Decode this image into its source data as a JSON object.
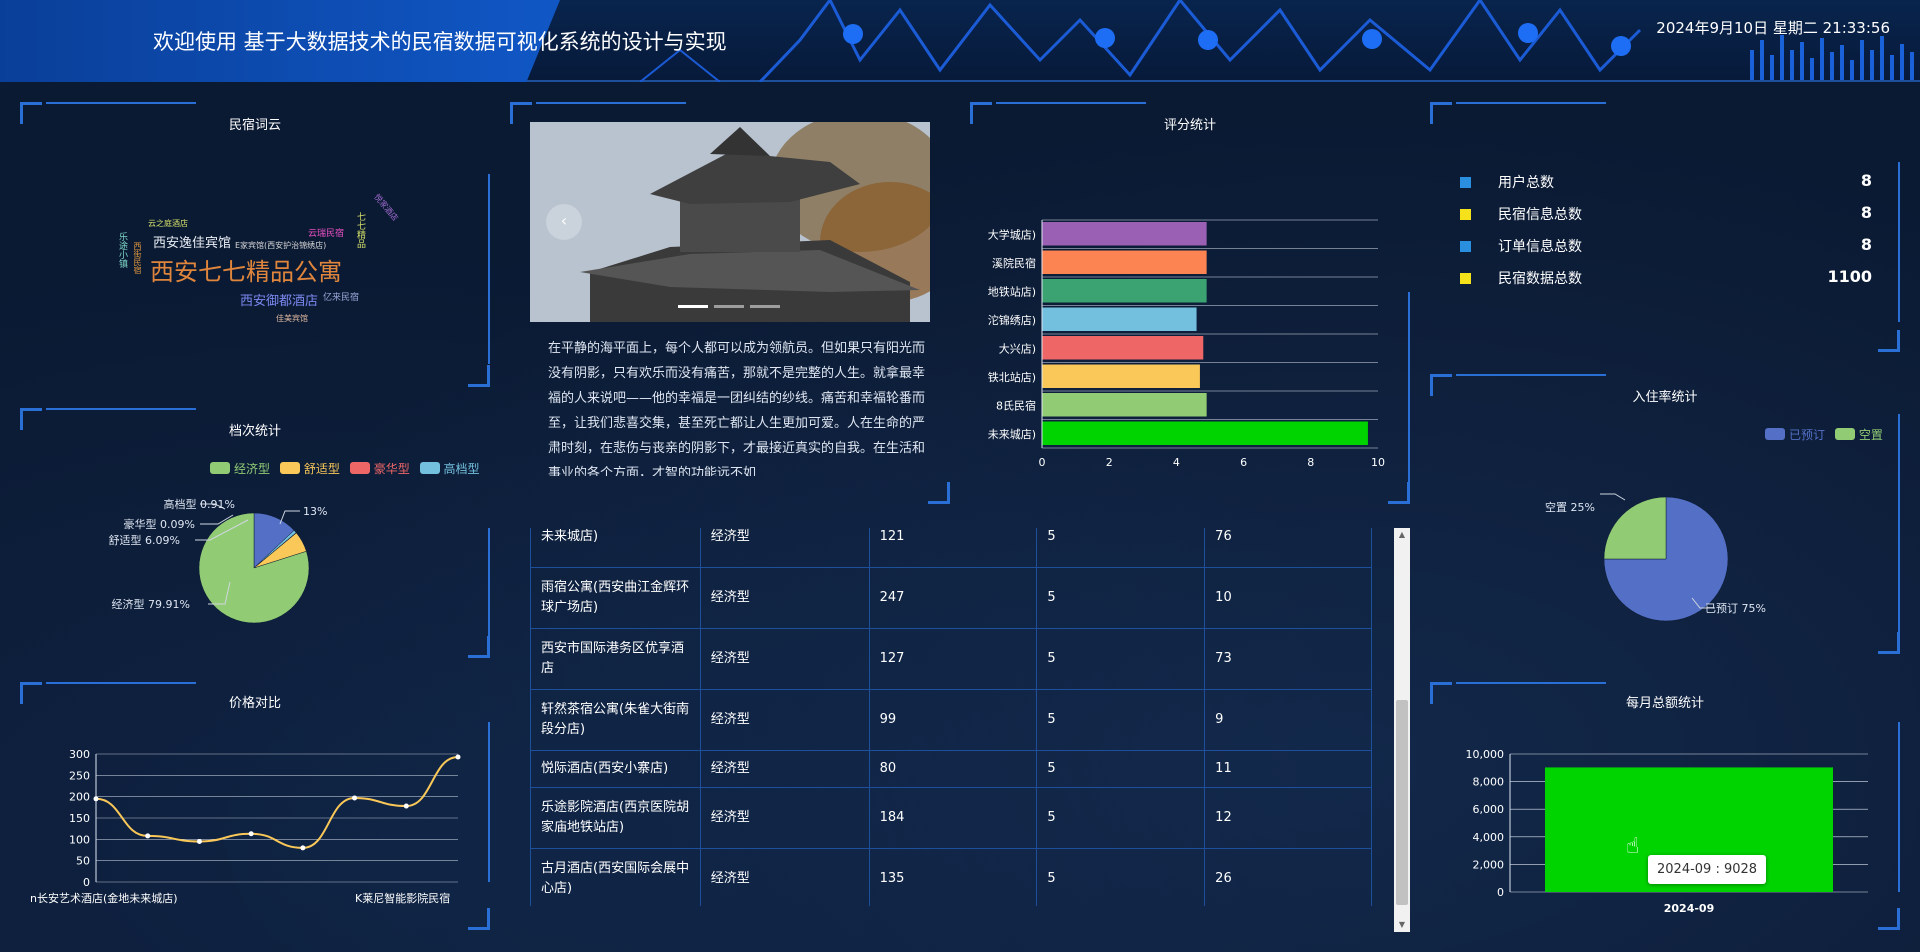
{
  "header": {
    "title": "欢迎使用 基于大数据技术的民宿数据可视化系统的设计与实现",
    "clock": "2024年9月10日 星期二 21:33:56"
  },
  "wordcloud": {
    "title": "民宿词云",
    "words": [
      {
        "text": "西安七七精品公寓",
        "color": "#e0863c"
      },
      {
        "text": "西安逸佳宾馆",
        "color": "#e9eef5"
      },
      {
        "text": "西安御都酒店",
        "color": "#7b88f0"
      },
      {
        "text": "E家宾馆(西安护治锦绣店)",
        "color": "#d8d8d8"
      },
      {
        "text": "云之庭酒店",
        "color": "#d6e26a"
      },
      {
        "text": "云瑞民宿",
        "color": "#e84fc2"
      },
      {
        "text": "亿来民宿",
        "color": "#9aa5d8"
      },
      {
        "text": "佳美宾馆",
        "color": "#e0b9a0"
      },
      {
        "text": "七七精品",
        "color": "#d6e26a"
      },
      {
        "text": "悦家酒店",
        "color": "#a06cd0"
      },
      {
        "text": "乐途小镇",
        "color": "#7fd8c8"
      },
      {
        "text": "西街民宿",
        "color": "#e59a3c"
      }
    ]
  },
  "grade_chart": {
    "title": "档次统计",
    "chart_data": {
      "type": "pie",
      "categories": [
        "经济型",
        "舒适型",
        "豪华型",
        "高档型"
      ],
      "values": [
        79.91,
        6.09,
        0.09,
        0.91
      ],
      "extra_label": "13%",
      "colors": [
        "#91cc75",
        "#fac858",
        "#ee6666",
        "#73c0de",
        "#5470c6"
      ],
      "labels": [
        "经济型 79.91%",
        "舒适型 6.09%",
        "豪华型 0.09%",
        "高档型 0.91%",
        "13%"
      ]
    }
  },
  "price_chart": {
    "title": "价格对比",
    "chart_data": {
      "type": "line",
      "x_tick_labels": [
        "n长安艺术酒店(金地未来城店)",
        "K莱尼智能影院民宿"
      ],
      "values": [
        195,
        108,
        95,
        113,
        80,
        197,
        178,
        293
      ],
      "ylim": [
        0,
        300
      ],
      "yticks": [
        0,
        50,
        100,
        150,
        200,
        250,
        300
      ]
    }
  },
  "intro": {
    "prev_arrow": "‹",
    "text": "在平静的海平面上，每个人都可以成为领航员。但如果只有阳光而没有阴影，只有欢乐而没有痛苦，那就不是完整的人生。就拿最幸福的人来说吧——他的幸福是一团纠结的纱线。痛苦和幸福轮番而至，让我们悲喜交集，甚至死亡都让人生更加可爱。人在生命的严肃时刻，在悲伤与丧亲的阴影下，才最接近真实的自我。在生活和事业的各个方面，才智的功能远不如"
  },
  "rating_chart": {
    "title": "评分统计",
    "chart_data": {
      "type": "bar",
      "orientation": "horizontal",
      "categories": [
        "大学城店)",
        "溪院民宿",
        "地铁站店)",
        "沱锦绣店)",
        "大兴店)",
        "铁北站店)",
        "8氏民宿",
        "未来城店)"
      ],
      "values": [
        4.9,
        4.9,
        4.9,
        4.6,
        4.8,
        4.7,
        4.9,
        9.7
      ],
      "colors": [
        "#9a60b4",
        "#fc8452",
        "#3ba272",
        "#73c0de",
        "#ee6666",
        "#fac858",
        "#91cc75",
        "#00d400"
      ],
      "xlim": [
        0,
        10
      ],
      "xticks": [
        0,
        2,
        4,
        6,
        8,
        10
      ]
    }
  },
  "stats": {
    "rows": [
      {
        "label": "用户总数",
        "value": "8",
        "color": "#2b8fe0"
      },
      {
        "label": "民宿信息总数",
        "value": "8",
        "color": "#f6e21a"
      },
      {
        "label": "订单信息总数",
        "value": "8",
        "color": "#2b8fe0"
      },
      {
        "label": "民宿数据总数",
        "value": "1100",
        "color": "#f6e21a"
      }
    ]
  },
  "occupancy_chart": {
    "title": "入住率统计",
    "chart_data": {
      "type": "pie",
      "categories": [
        "已预订",
        "空置"
      ],
      "values": [
        75,
        25
      ],
      "colors": [
        "#5470c6",
        "#91cc75"
      ],
      "labels": [
        "已预订 75%",
        "空置 25%"
      ]
    }
  },
  "monthly_chart": {
    "title": "每月总额统计",
    "chart_data": {
      "type": "bar",
      "categories": [
        "2024-09"
      ],
      "values": [
        9028
      ],
      "ylim": [
        0,
        10000
      ],
      "yticks": [
        "0",
        "2,000",
        "4,000",
        "6,000",
        "8,000",
        "10,000"
      ],
      "color": "#00d400"
    },
    "tooltip": "2024-09 : 9028"
  },
  "table": {
    "rows": [
      [
        "未来城店)",
        "经济型",
        "121",
        "5",
        "76"
      ],
      [
        "雨宿公寓(西安曲江金辉环球广场店)",
        "经济型",
        "247",
        "5",
        "10"
      ],
      [
        "西安市国际港务区优享酒店",
        "经济型",
        "127",
        "5",
        "73"
      ],
      [
        "轩然茶宿公寓(朱雀大街南段分店)",
        "经济型",
        "99",
        "5",
        "9"
      ],
      [
        "悦际酒店(西安小寨店)",
        "经济型",
        "80",
        "5",
        "11"
      ],
      [
        "乐途影院酒店(西京医院胡家庙地铁站店)",
        "经济型",
        "184",
        "5",
        "12"
      ],
      [
        "古月酒店(西安国际会展中心店)",
        "经济型",
        "135",
        "5",
        "26"
      ]
    ]
  }
}
